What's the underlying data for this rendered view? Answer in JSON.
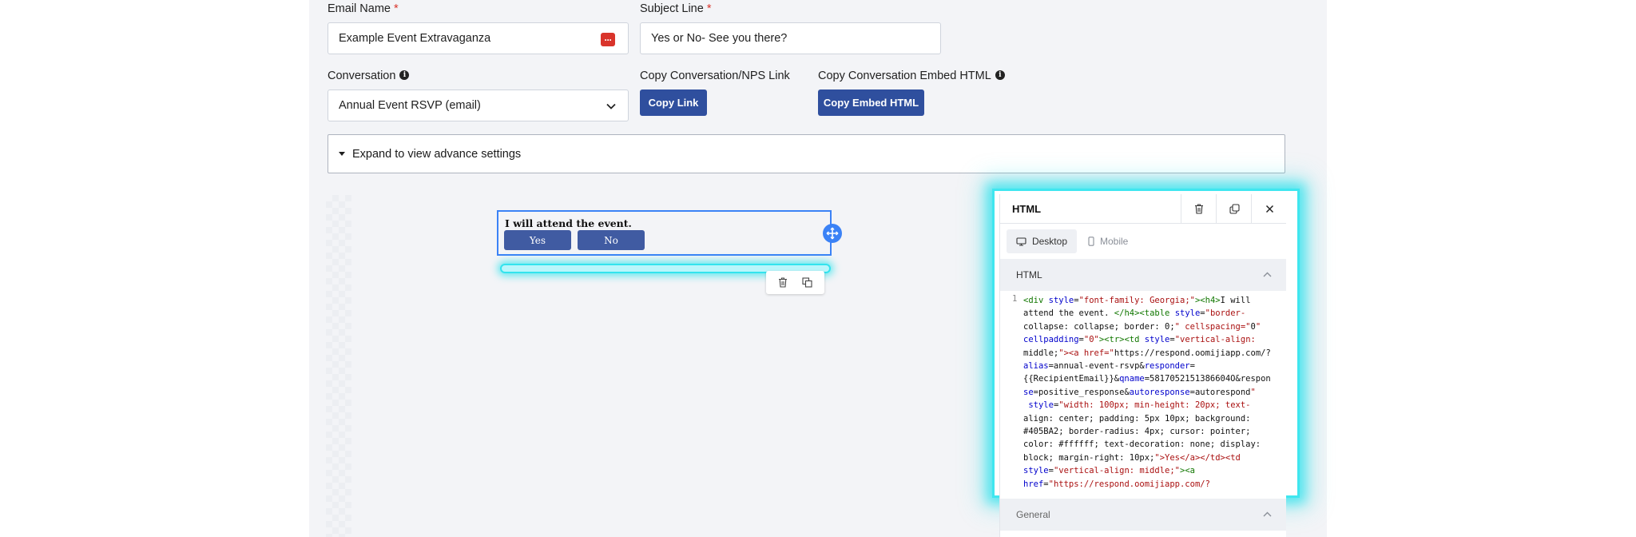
{
  "form": {
    "email_name_label": "Email Name",
    "email_name_value": "Example Event Extravaganza",
    "subject_line_label": "Subject Line",
    "subject_line_value": "Yes or No- See you there?",
    "required_mark": "*",
    "conversation_label": "Conversation",
    "conversation_value": "Annual Event RSVP (email)",
    "copy_link_label": "Copy Conversation/NPS Link",
    "copy_link_button": "Copy Link",
    "copy_embed_label": "Copy Conversation Embed HTML",
    "copy_embed_button": "Copy Embed HTML",
    "expander_label": "Expand to view advance settings",
    "info_glyph": "i",
    "dots_glyph": "···"
  },
  "canvas": {
    "block_title": "I will attend the event.",
    "yes_button": "Yes",
    "no_button": "No",
    "button_color": "#405BA2"
  },
  "panel": {
    "title": "HTML",
    "tabs": [
      "Desktop",
      "Mobile"
    ],
    "active_tab": "Desktop",
    "html_section": "HTML",
    "general_section": "General",
    "line_number": "1",
    "code_lines": [
      "<div style=\"font-family: Georgia;\"><h4>I will",
      "attend the event. </h4><table style=\"border-",
      "collapse: collapse; border: 0;\" cellspacing=\"0\"",
      "cellpadding=\"0\"><tr><td style=\"vertical-align:",
      "middle;\"><a href=\"https://respond.oomijiapp.com/?",
      "alias=annual-event-rsvp&responder=",
      "{{RecipientEmail}}&qname=5817052151386604O&respon",
      "se=positive_response&autoresponse=autorespond\"",
      " style=\"width: 100px; min-height: 20px; text-",
      "align: center; padding: 5px 10px; background:",
      "#405BA2; border-radius: 4px; cursor: pointer;",
      "color: #ffffff; text-decoration: none; display:",
      "block; margin-right: 10px;\">Yes</a></td><td",
      "style=\"vertical-align: middle;\"><a",
      "href=\"https://respond.oomijiapp.com/?"
    ]
  },
  "colors": {
    "primary_button": "#2F4F9E",
    "selection_blue": "#3B82F6",
    "highlight_cyan": "#3FE6EF",
    "required_red": "#D9342B"
  }
}
